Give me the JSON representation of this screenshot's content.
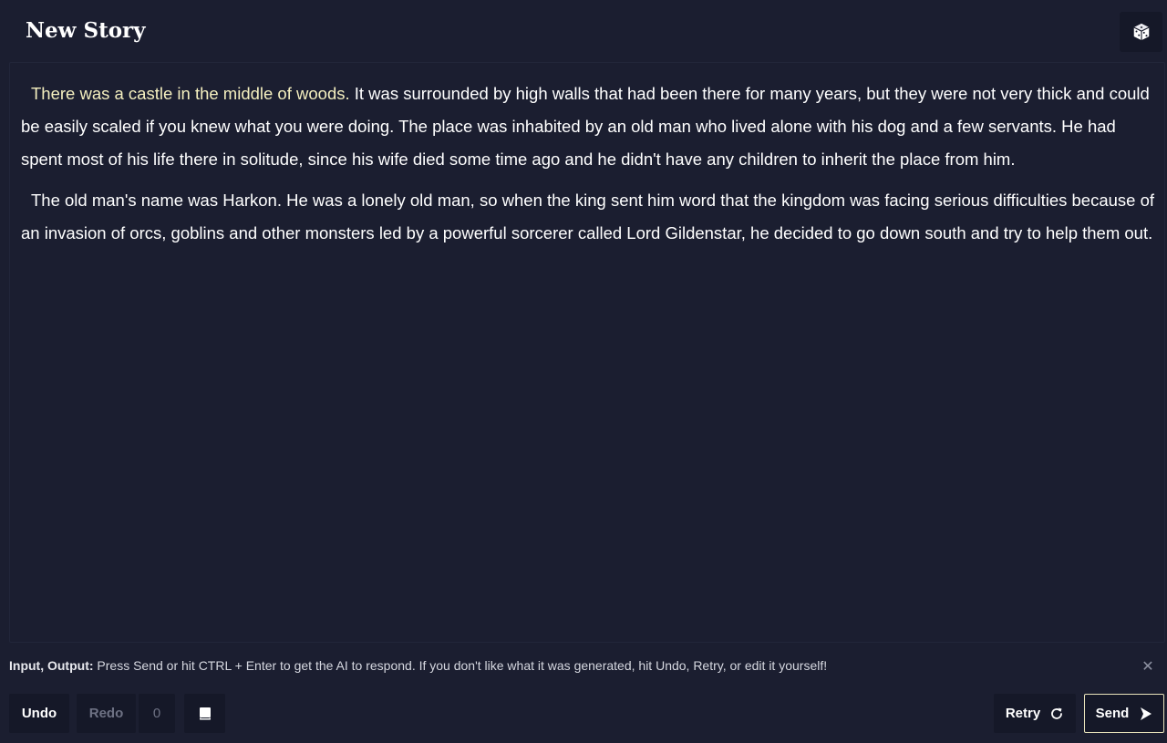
{
  "header": {
    "title": "New Story",
    "dice_icon": "dice-icon"
  },
  "story": {
    "paragraphs": [
      {
        "highlighted": "There was a castle in the middle of woods.",
        "text": " It was surrounded by high walls that had been there for many years, but they were not very thick and could be easily scaled if you knew what you were doing. The place was inhabited by an old man who lived alone with his dog and a few servants. He had spent most of his life there in solitude, since his wife died some time ago and he didn't have any children to inherit the place from him."
      },
      {
        "highlighted": "",
        "text": "The old man's name was Harkon. He was a lonely old man, so when the king sent him word that the kingdom was facing serious difficulties because of an invasion of orcs, goblins and other monsters led by a powerful sorcerer called Lord Gildenstar, he decided to go down south and try to help them out."
      }
    ]
  },
  "info": {
    "label": "Input, Output:",
    "message": " Press Send or hit CTRL + Enter to get the AI to respond. If you don't like what it was generated, hit Undo, Retry, or edit it yourself!",
    "close_symbol": "✕"
  },
  "toolbar": {
    "undo_label": "Undo",
    "redo_label": "Redo",
    "count": "0",
    "book_icon": "book-icon",
    "retry_label": "Retry",
    "retry_icon": "refresh-icon",
    "send_label": "Send",
    "send_icon": "send-arrow-icon"
  },
  "colors": {
    "background": "#1b1e30",
    "button_bg": "#151828",
    "highlight_text": "#f4efbf",
    "send_border": "#e8e3bb"
  }
}
